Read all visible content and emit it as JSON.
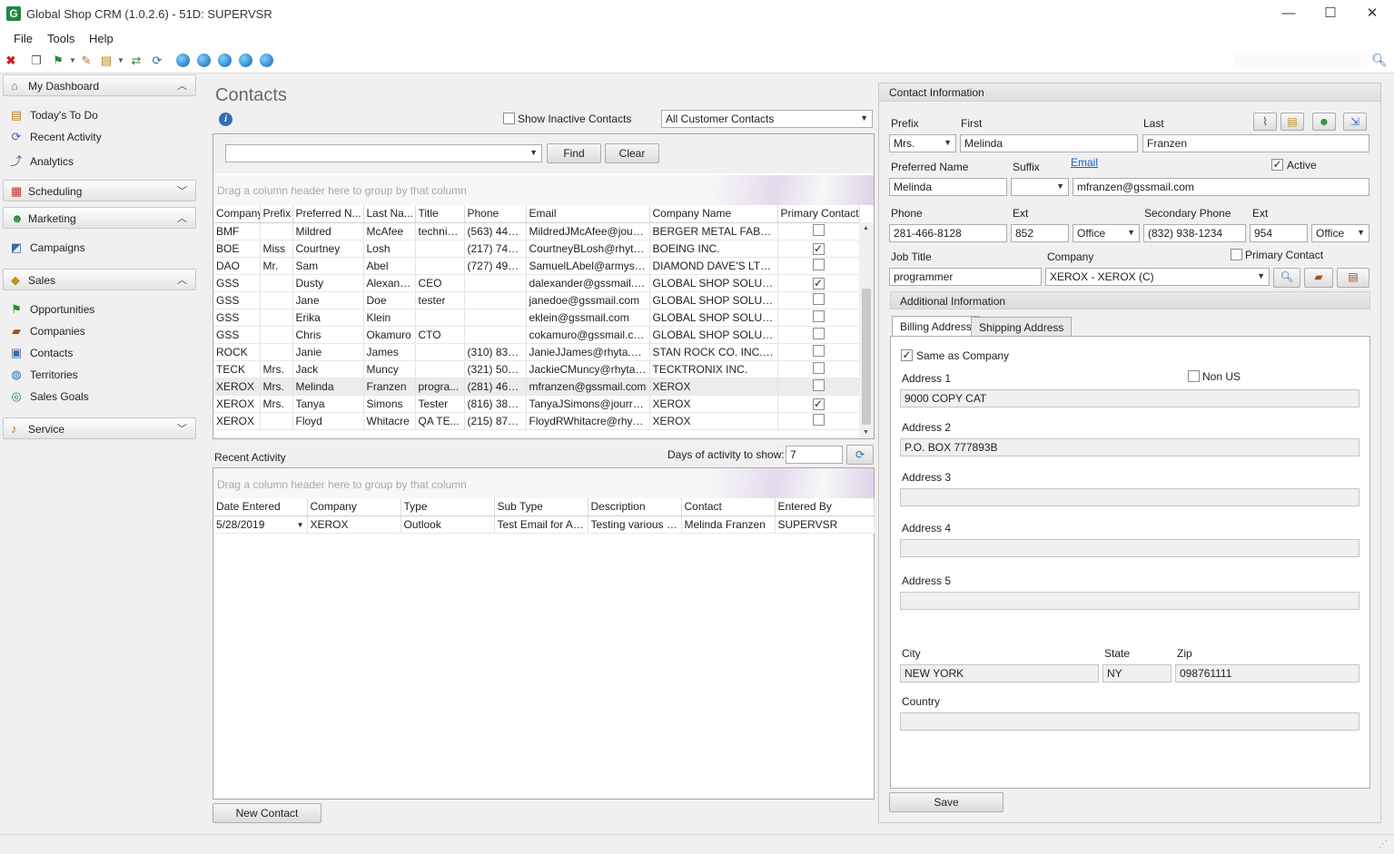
{
  "window": {
    "title": "Global Shop CRM (1.0.2.6) - 51D: SUPERVSR",
    "app_icon": "G",
    "minimize": "—",
    "maximize": "☐",
    "close": "✕"
  },
  "menu": [
    "File",
    "Tools",
    "Help"
  ],
  "sidebar": {
    "dashboard": {
      "label": "My Dashboard",
      "items": [
        "Today's To Do",
        "Recent Activity",
        "Analytics"
      ]
    },
    "scheduling": {
      "label": "Scheduling"
    },
    "marketing": {
      "label": "Marketing",
      "items": [
        "Campaigns"
      ]
    },
    "sales": {
      "label": "Sales",
      "items": [
        "Opportunities",
        "Companies",
        "Contacts",
        "Territories",
        "Sales Goals"
      ]
    },
    "service": {
      "label": "Service"
    }
  },
  "contacts": {
    "title": "Contacts",
    "show_inactive_label": "Show Inactive Contacts",
    "filter_value": "All Customer Contacts",
    "find_label": "Find",
    "clear_label": "Clear",
    "group_hint": "Drag a column header here to group by that column",
    "columns": [
      "Company",
      "Prefix",
      "Preferred N...",
      "Last Na...",
      "Title",
      "Phone",
      "Email",
      "Company Name",
      "Primary Contact"
    ],
    "rows": [
      {
        "company": "BMF",
        "prefix": "",
        "preferred": "Mildred",
        "last": "McAfee",
        "title": "technic...",
        "phone": "(563) 445...",
        "email": "MildredJMcAfee@jourra...",
        "company_name": "BERGER METAL FABRICA...",
        "primary": false
      },
      {
        "company": "BOE",
        "prefix": "Miss",
        "preferred": "Courtney",
        "last": "Losh",
        "title": "",
        "phone": "(217) 745...",
        "email": "CourtneyBLosh@rhyta....",
        "company_name": "BOEING INC.",
        "primary": true
      },
      {
        "company": "DAO",
        "prefix": "Mr.",
        "preferred": "Sam",
        "last": "Abel",
        "title": "",
        "phone": "(727) 497...",
        "email": "SamuelLAbel@armyspy....",
        "company_name": "DIAMOND DAVE'S LTD.   ...",
        "primary": false
      },
      {
        "company": "GSS",
        "prefix": "",
        "preferred": "Dusty",
        "last": "Alexander",
        "title": "CEO",
        "phone": "",
        "email": "dalexander@gssmail.com",
        "company_name": "GLOBAL SHOP SOLUTIO...",
        "primary": true
      },
      {
        "company": "GSS",
        "prefix": "",
        "preferred": "Jane",
        "last": "Doe",
        "title": "tester",
        "phone": "",
        "email": "janedoe@gssmail.com",
        "company_name": "GLOBAL SHOP SOLUTIO...",
        "primary": false
      },
      {
        "company": "GSS",
        "prefix": "",
        "preferred": "Erika",
        "last": "Klein",
        "title": "",
        "phone": "",
        "email": "eklein@gssmail.com",
        "company_name": "GLOBAL SHOP SOLUTIO...",
        "primary": false
      },
      {
        "company": "GSS",
        "prefix": "",
        "preferred": "Chris",
        "last": "Okamuro",
        "title": "CTO",
        "phone": "",
        "email": "cokamuro@gssmail.com",
        "company_name": "GLOBAL SHOP SOLUTIO...",
        "primary": false
      },
      {
        "company": "ROCK",
        "prefix": "",
        "preferred": "Janie",
        "last": "James",
        "title": "",
        "phone": "(310) 835...",
        "email": "JanieJJames@rhyta.com",
        "company_name": "STAN ROCK CO. INC.    ...",
        "primary": false
      },
      {
        "company": "TECK",
        "prefix": "Mrs.",
        "preferred": "Jack",
        "last": "Muncy",
        "title": "",
        "phone": "(321) 501...",
        "email": "JackieCMuncy@rhyta.com",
        "company_name": "TECKTRONIX INC.",
        "primary": false
      },
      {
        "company": "XEROX",
        "prefix": "Mrs.",
        "preferred": "Melinda",
        "last": "Franzen",
        "title": "progra...",
        "phone": "(281) 466...",
        "email": "mfranzen@gssmail.com",
        "company_name": "XEROX",
        "primary": false
      },
      {
        "company": "XEROX",
        "prefix": "Mrs.",
        "preferred": "Tanya",
        "last": "Simons",
        "title": "Tester",
        "phone": "(816) 389...",
        "email": "TanyaJSimons@jourrapi...",
        "company_name": "XEROX",
        "primary": true
      },
      {
        "company": "XEROX",
        "prefix": "",
        "preferred": "Floyd",
        "last": "Whitacre",
        "title": "QA TE...",
        "phone": "(215) 873...",
        "email": "FloydRWhitacre@rhyta....",
        "company_name": "XEROX",
        "primary": false
      }
    ],
    "new_contact_label": "New Contact"
  },
  "recent_activity": {
    "title": "Recent Activity",
    "days_label": "Days of activity to show:",
    "days_value": "7",
    "group_hint": "Drag a column header here to group by that column",
    "columns": [
      "Date Entered",
      "Company",
      "Type",
      "Sub Type",
      "Description",
      "Contact",
      "Entered By"
    ],
    "rows": [
      {
        "date": "5/28/2019",
        "company": "XEROX",
        "type": "Outlook",
        "subtype": "Test Email for Att...",
        "description": "Testing various f...",
        "contact": "Melinda Franzen",
        "entered_by": "SUPERVSR"
      }
    ]
  },
  "contact_info": {
    "header": "Contact Information",
    "prefix_label": "Prefix",
    "prefix": "Mrs.",
    "first_label": "First",
    "first": "Melinda",
    "last_label": "Last",
    "last": "Franzen",
    "preferred_label": "Preferred Name",
    "preferred": "Melinda",
    "suffix_label": "Suffix",
    "suffix": "",
    "email_label": "Email",
    "email": "mfranzen@gssmail.com",
    "active_label": "Active",
    "phone_label": "Phone",
    "phone": "281-466-8128",
    "ext_label": "Ext",
    "ext": "852",
    "phone_type": "Office",
    "secondary_label": "Secondary Phone",
    "secondary": "(832) 938-1234",
    "ext2_label": "Ext",
    "ext2": "954",
    "secondary_type": "Office",
    "job_title_label": "Job Title",
    "job_title": "programmer",
    "company_label": "Company",
    "company": "XEROX - XEROX (C)",
    "primary_contact_label": "Primary Contact",
    "additional_label": "Additional Information",
    "tabs": [
      "Billing Address",
      "Shipping Address"
    ],
    "same_as_company_label": "Same as Company",
    "non_us_label": "Non US",
    "address1_label": "Address 1",
    "address1": "9000 COPY CAT",
    "address2_label": "Address 2",
    "address2": "P.O. BOX 777893B",
    "address3_label": "Address 3",
    "address3": "",
    "address4_label": "Address 4",
    "address4": "",
    "address5_label": "Address 5",
    "address5": "",
    "city_label": "City",
    "city": "NEW YORK",
    "state_label": "State",
    "state": "NY",
    "zip_label": "Zip",
    "zip": "098761111",
    "country_label": "Country",
    "country": "",
    "save_label": "Save"
  }
}
